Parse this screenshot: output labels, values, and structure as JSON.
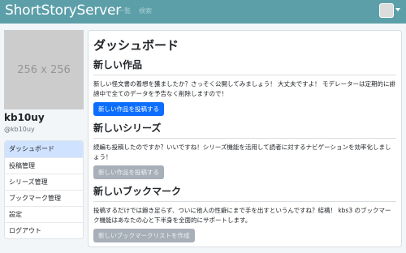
{
  "navbar": {
    "brand": "ShortStoryServer",
    "links": [
      "一覧",
      "検索"
    ]
  },
  "sidebar": {
    "avatar_placeholder": "256 x 256",
    "username": "kb10uy",
    "handle": "@kb10uy",
    "menu": [
      "ダッシュボード",
      "投稿管理",
      "シリーズ管理",
      "ブックマーク管理",
      "設定",
      "ログアウト"
    ],
    "active_index": 0
  },
  "main": {
    "title": "ダッシュボード",
    "sections": [
      {
        "title": "新しい作品",
        "text": "新しい怪文書の着想を獲ましたか？さっそく公開してみましょう！ 大丈夫ですよ！ モデレーターは定期的に誹謗中で全てのデータを予告なく削除しますので！",
        "button": "新しい作品を投稿する",
        "button_enabled": true
      },
      {
        "title": "新しいシリーズ",
        "text": "続編も投稿したのですか？いいですね！シリーズ機能を活用して読者に対するナビゲーションを効率化しましょう！",
        "button": "新しい作品を投稿する",
        "button_enabled": false
      },
      {
        "title": "新しいブックマーク",
        "text": "投稿するだけでは飽き足らず、ついに他人の性癖にまで手を出すというんですね？結構！ kbs3 のブックマーク機能はあなたの心と下半身を全面的にサポートします。",
        "button": "新しいブックマークリストを作成",
        "button_enabled": false
      }
    ]
  },
  "colors": {
    "navbar": "#5c9fa9",
    "primary": "#0d6efd",
    "disabled": "#a7b0b9",
    "active_menu": "#cfe2ff"
  }
}
